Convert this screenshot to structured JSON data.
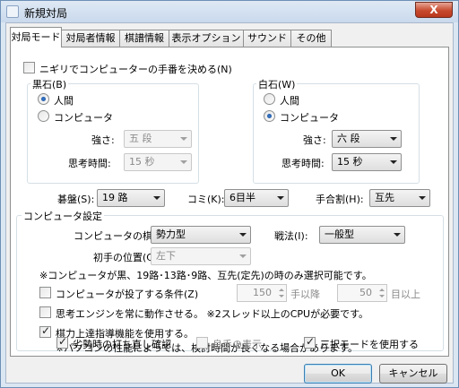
{
  "window": {
    "title": "新規対局",
    "close": "X"
  },
  "tabs": [
    "対局モード",
    "対局者情報",
    "棋譜情報",
    "表示オプション",
    "サウンド",
    "その他"
  ],
  "nigiri": {
    "label": "ニギリでコンピューターの手番を決める(N)",
    "checked": false
  },
  "black": {
    "title": "黒石(B)",
    "human": "人間",
    "computer": "コンピュータ",
    "selected": "human",
    "strength_label": "強さ:",
    "strength": "五 段",
    "time_label": "思考時間:",
    "time": "15 秒"
  },
  "white": {
    "title": "白石(W)",
    "human": "人間",
    "computer": "コンピュータ",
    "selected": "computer",
    "strength_label": "強さ:",
    "strength": "六 段",
    "time_label": "思考時間:",
    "time": "15 秒"
  },
  "board": {
    "label": "碁盤(S):",
    "value": "19 路"
  },
  "komi": {
    "label": "コミ(K):",
    "value": "6目半"
  },
  "handicap": {
    "label": "手合割(H):",
    "value": "互先"
  },
  "computer_settings": {
    "title": "コンピュータ設定",
    "style_label": "コンピュータの棋風:",
    "style": "勢力型",
    "tactic_label": "戦法(I):",
    "tactic": "一般型",
    "first_pos_label": "初手の位置(C):",
    "first_pos": "左下",
    "note": "※コンピュータが黒、19路･13路･9路、互先(定先)の時のみ選択可能です。",
    "resign": {
      "label": "コンピュータが投了する条件(Z)",
      "checked": false,
      "moves": "150",
      "moves_unit": "手以降",
      "points": "50",
      "points_unit": "目以上"
    },
    "ponder": {
      "label": "思考エンジンを常に動作させる。 ※2スレッド以上のCPUが必要です。",
      "checked": false
    },
    "guidance": {
      "label": "棋力上達指導機能を使用する。",
      "checked": true,
      "note": "※パソコンの性能によっては、検討時間が長くなる場合があります。"
    },
    "retry": {
      "label": "劣勢時の打ち直し確認",
      "checked": true
    },
    "good_move": {
      "label": "良手の表示",
      "checked": false
    },
    "three_choice": {
      "label": "三択モードを使用する",
      "checked": true
    }
  },
  "buttons": {
    "ok": "OK",
    "cancel": "キャンセル"
  }
}
